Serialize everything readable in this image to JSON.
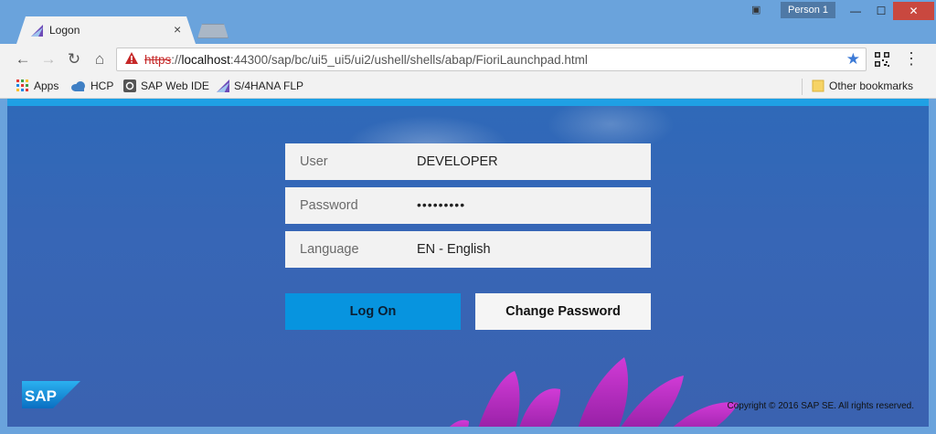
{
  "browser": {
    "tab_title": "Logon",
    "tab_close": "×",
    "profile_label": "Person 1",
    "window_controls": {
      "minimize": "—",
      "maximize": "☐",
      "close": "✕"
    },
    "url_scheme": "https",
    "url_sep": "://",
    "url_host": "localhost",
    "url_path": ":44300/sap/bc/ui5_ui5/ui2/ushell/shells/abap/FioriLaunchpad.html",
    "nav": {
      "back": "←",
      "forward": "→",
      "reload": "↻",
      "home": "⌂"
    },
    "star": "★",
    "menu": "⋮",
    "bookmarks": [
      {
        "label": "Apps",
        "icon": "apps-grid-icon"
      },
      {
        "label": "HCP",
        "icon": "cloud-icon"
      },
      {
        "label": "SAP Web IDE",
        "icon": "web-ide-icon"
      },
      {
        "label": "S/4HANA FLP",
        "icon": "fiori-icon"
      }
    ],
    "other_bookmarks": "Other bookmarks"
  },
  "logon": {
    "user_label": "User",
    "user_value": "DEVELOPER",
    "password_label": "Password",
    "password_value": "•••••••••",
    "language_label": "Language",
    "language_value": "EN - English",
    "logon_button": "Log On",
    "change_password_button": "Change Password",
    "logo_text": "SAP",
    "copyright": "Copyright © 2016 SAP SE. All rights reserved."
  },
  "colors": {
    "accent": "#0794df",
    "stripe": "#1fa0e4",
    "background": "#3766b6",
    "warning": "#c62828"
  }
}
